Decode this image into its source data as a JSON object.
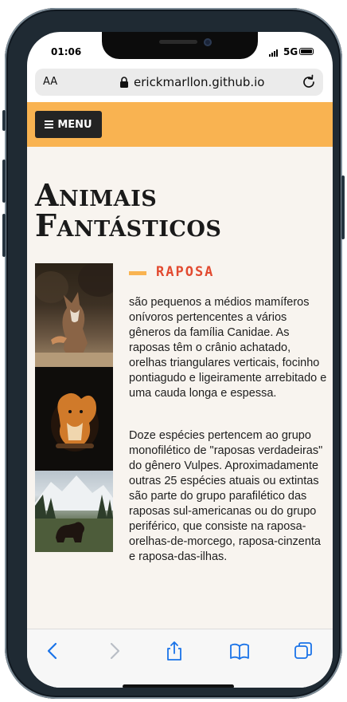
{
  "status": {
    "time": "01:06",
    "network": "5G"
  },
  "browser": {
    "text_size_label": "AA",
    "url": "erickmarllon.github.io"
  },
  "nav": {
    "menu_label": "MENU"
  },
  "page": {
    "title_line1": "Animais",
    "title_line2": "Fantásticos",
    "animal": {
      "name": "RAPOSA",
      "paragraph1": "são pequenos a médios mamíferos onívoros pertencentes a vários gêneros da família Canidae. As raposas têm o crânio achatado, orelhas triangulares verticais, focinho pontiagudo e ligeiramente arrebitado e uma cauda longa e espessa.",
      "paragraph2": "Doze espécies pertencem ao grupo monofilético de \"raposas verdadeiras\" do gênero Vulpes. Aproximadamente outras 25 espécies atuais ou extintas são parte do grupo parafilético das raposas sul-americanas ou do grupo periférico, que consiste na raposa-orelhas-de-morcego, raposa-cinzenta e raposa-das-ilhas."
    },
    "images": [
      {
        "icon": "fox-photo"
      },
      {
        "icon": "squirrel-photo"
      },
      {
        "icon": "bear-photo"
      }
    ]
  },
  "colors": {
    "menu_bar": "#f9b351",
    "menu_button": "#242424",
    "accent_name": "#e24a30",
    "page_bg": "#f8f4ef",
    "ios_blue": "#1a73e8"
  }
}
